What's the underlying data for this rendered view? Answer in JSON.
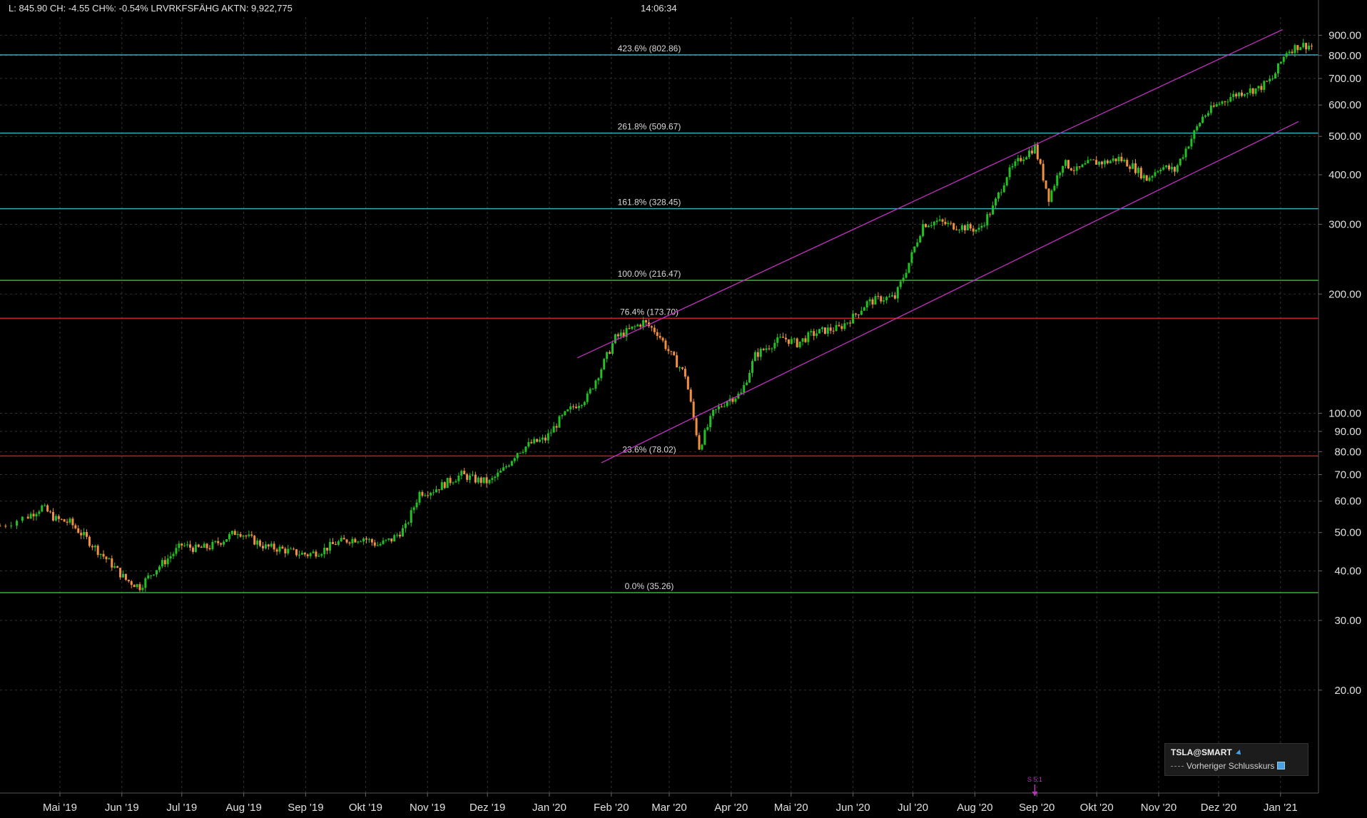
{
  "header": {
    "quote": "L: 845.90 CH: -4.55 CH%: -0.54% LRVRKFSFÄHG AKTN: 9,922,775",
    "time": "14:06:34"
  },
  "legend": {
    "title": "TSLA@SMART",
    "subtitle": "Vorheriger Schlusskurs"
  },
  "event_marker": "S 5:1",
  "colors": {
    "background": "#000000",
    "up": "#22c022",
    "down": "#f09040",
    "channel": "#c030c0",
    "fib_cyan": "#3aa8b8",
    "fib_green": "#36b236",
    "fib_red": "#c02020",
    "grid": "#333333"
  },
  "chart_data": {
    "type": "candlestick",
    "y_scale": "log",
    "ylim": [
      11,
      1000
    ],
    "y_ticks": [
      {
        "v": 900,
        "label": "900.00"
      },
      {
        "v": 800,
        "label": "800.00"
      },
      {
        "v": 700,
        "label": "700.00"
      },
      {
        "v": 600,
        "label": "600.00"
      },
      {
        "v": 500,
        "label": "500.00"
      },
      {
        "v": 400,
        "label": "400.00"
      },
      {
        "v": 300,
        "label": "300.00"
      },
      {
        "v": 200,
        "label": "200.00"
      },
      {
        "v": 100,
        "label": "100.00"
      },
      {
        "v": 90,
        "label": "90.00"
      },
      {
        "v": 80,
        "label": "80.00"
      },
      {
        "v": 70,
        "label": "70.00"
      },
      {
        "v": 60,
        "label": "60.00"
      },
      {
        "v": 50,
        "label": "50.00"
      },
      {
        "v": 40,
        "label": "40.00"
      },
      {
        "v": 30,
        "label": "30.00"
      },
      {
        "v": 20,
        "label": "20.00"
      }
    ],
    "x_ticks": [
      {
        "date": "2019-05-01",
        "label": "Mai '19"
      },
      {
        "date": "2019-06-01",
        "label": "Jun '19"
      },
      {
        "date": "2019-07-01",
        "label": "Jul '19"
      },
      {
        "date": "2019-08-01",
        "label": "Aug '19"
      },
      {
        "date": "2019-09-01",
        "label": "Sep '19"
      },
      {
        "date": "2019-10-01",
        "label": "Okt '19"
      },
      {
        "date": "2019-11-01",
        "label": "Nov '19"
      },
      {
        "date": "2019-12-01",
        "label": "Dez '19"
      },
      {
        "date": "2020-01-01",
        "label": "Jan '20"
      },
      {
        "date": "2020-02-01",
        "label": "Feb '20"
      },
      {
        "date": "2020-03-01",
        "label": "Mar '20"
      },
      {
        "date": "2020-04-01",
        "label": "Apr '20"
      },
      {
        "date": "2020-05-01",
        "label": "Mai '20"
      },
      {
        "date": "2020-06-01",
        "label": "Jun '20"
      },
      {
        "date": "2020-07-01",
        "label": "Jul '20"
      },
      {
        "date": "2020-08-01",
        "label": "Aug '20"
      },
      {
        "date": "2020-09-01",
        "label": "Sep '20"
      },
      {
        "date": "2020-10-01",
        "label": "Okt '20"
      },
      {
        "date": "2020-11-01",
        "label": "Nov '20"
      },
      {
        "date": "2020-12-01",
        "label": "Dez '20"
      },
      {
        "date": "2021-01-01",
        "label": "Jan '21"
      }
    ],
    "xlim": [
      "2019-04-01",
      "2021-01-20"
    ],
    "fib_levels": [
      {
        "label": "423.6% (802.86)",
        "value": 802.86,
        "color": "#3aa8b8"
      },
      {
        "label": "261.8% (509.67)",
        "value": 509.67,
        "color": "#3aa8b8"
      },
      {
        "label": "161.8% (328.45)",
        "value": 328.45,
        "color": "#3aa8b8"
      },
      {
        "label": "100.0% (216.47)",
        "value": 216.47,
        "color": "#36b236"
      },
      {
        "label": "76.4% (173.70)",
        "value": 173.7,
        "color": "#c02020"
      },
      {
        "label": "23.6% (78.02)",
        "value": 78.02,
        "color": "#c02020"
      },
      {
        "label": "0.0% (35.26)",
        "value": 35.26,
        "color": "#36b236"
      }
    ],
    "channel": [
      {
        "x1": "2020-01-15",
        "y1": 138,
        "x2": "2021-01-02",
        "y2": 930
      },
      {
        "x1": "2020-01-27",
        "y1": 75,
        "x2": "2021-01-10",
        "y2": 545
      }
    ],
    "event_date": "2020-08-31",
    "series": [
      {
        "date": "2019-04-01",
        "close": 52.0
      },
      {
        "date": "2019-04-15",
        "close": 55.0
      },
      {
        "date": "2019-04-22",
        "close": 58.0
      },
      {
        "date": "2019-04-29",
        "close": 54.0
      },
      {
        "date": "2019-05-06",
        "close": 53.0
      },
      {
        "date": "2019-05-13",
        "close": 49.0
      },
      {
        "date": "2019-05-20",
        "close": 45.0
      },
      {
        "date": "2019-05-27",
        "close": 41.5
      },
      {
        "date": "2019-06-03",
        "close": 38.0
      },
      {
        "date": "2019-06-10",
        "close": 36.5
      },
      {
        "date": "2019-06-17",
        "close": 40.0
      },
      {
        "date": "2019-06-24",
        "close": 43.0
      },
      {
        "date": "2019-07-01",
        "close": 46.5
      },
      {
        "date": "2019-07-08",
        "close": 45.5
      },
      {
        "date": "2019-07-15",
        "close": 46.0
      },
      {
        "date": "2019-07-22",
        "close": 48.0
      },
      {
        "date": "2019-07-29",
        "close": 50.5
      },
      {
        "date": "2019-08-05",
        "close": 48.0
      },
      {
        "date": "2019-08-12",
        "close": 46.0
      },
      {
        "date": "2019-08-19",
        "close": 45.5
      },
      {
        "date": "2019-08-26",
        "close": 44.5
      },
      {
        "date": "2019-09-02",
        "close": 44.0
      },
      {
        "date": "2019-09-09",
        "close": 45.0
      },
      {
        "date": "2019-09-16",
        "close": 47.0
      },
      {
        "date": "2019-09-23",
        "close": 48.0
      },
      {
        "date": "2019-09-30",
        "close": 48.5
      },
      {
        "date": "2019-10-07",
        "close": 46.5
      },
      {
        "date": "2019-10-14",
        "close": 48.0
      },
      {
        "date": "2019-10-21",
        "close": 51.5
      },
      {
        "date": "2019-10-28",
        "close": 63.0
      },
      {
        "date": "2019-11-04",
        "close": 64.0
      },
      {
        "date": "2019-11-11",
        "close": 67.0
      },
      {
        "date": "2019-11-18",
        "close": 70.0
      },
      {
        "date": "2019-11-25",
        "close": 68.0
      },
      {
        "date": "2019-12-02",
        "close": 67.0
      },
      {
        "date": "2019-12-09",
        "close": 72.0
      },
      {
        "date": "2019-12-16",
        "close": 80.0
      },
      {
        "date": "2019-12-23",
        "close": 84.0
      },
      {
        "date": "2019-12-30",
        "close": 86.0
      },
      {
        "date": "2020-01-06",
        "close": 96.0
      },
      {
        "date": "2020-01-13",
        "close": 104.0
      },
      {
        "date": "2020-01-20",
        "close": 110.0
      },
      {
        "date": "2020-01-27",
        "close": 130.0
      },
      {
        "date": "2020-02-03",
        "close": 155.0
      },
      {
        "date": "2020-02-10",
        "close": 162.0
      },
      {
        "date": "2020-02-17",
        "close": 170.0
      },
      {
        "date": "2020-02-24",
        "close": 160.0
      },
      {
        "date": "2020-03-02",
        "close": 140.0
      },
      {
        "date": "2020-03-09",
        "close": 125.0
      },
      {
        "date": "2020-03-16",
        "close": 82.0
      },
      {
        "date": "2020-03-23",
        "close": 100.0
      },
      {
        "date": "2020-03-30",
        "close": 108.0
      },
      {
        "date": "2020-04-06",
        "close": 112.0
      },
      {
        "date": "2020-04-13",
        "close": 140.0
      },
      {
        "date": "2020-04-20",
        "close": 148.0
      },
      {
        "date": "2020-04-27",
        "close": 155.0
      },
      {
        "date": "2020-05-04",
        "close": 150.0
      },
      {
        "date": "2020-05-11",
        "close": 158.0
      },
      {
        "date": "2020-05-18",
        "close": 162.0
      },
      {
        "date": "2020-05-25",
        "close": 164.0
      },
      {
        "date": "2020-06-01",
        "close": 175.0
      },
      {
        "date": "2020-06-08",
        "close": 190.0
      },
      {
        "date": "2020-06-15",
        "close": 195.0
      },
      {
        "date": "2020-06-22",
        "close": 196.0
      },
      {
        "date": "2020-06-29",
        "close": 240.0
      },
      {
        "date": "2020-07-06",
        "close": 300.0
      },
      {
        "date": "2020-07-13",
        "close": 305.0
      },
      {
        "date": "2020-07-20",
        "close": 298.0
      },
      {
        "date": "2020-07-27",
        "close": 295.0
      },
      {
        "date": "2020-08-03",
        "close": 290.0
      },
      {
        "date": "2020-08-10",
        "close": 330.0
      },
      {
        "date": "2020-08-17",
        "close": 400.0
      },
      {
        "date": "2020-08-24",
        "close": 440.0
      },
      {
        "date": "2020-08-31",
        "close": 470.0
      },
      {
        "date": "2020-09-07",
        "close": 350.0
      },
      {
        "date": "2020-09-14",
        "close": 430.0
      },
      {
        "date": "2020-09-21",
        "close": 410.0
      },
      {
        "date": "2020-09-28",
        "close": 430.0
      },
      {
        "date": "2020-10-05",
        "close": 430.0
      },
      {
        "date": "2020-10-12",
        "close": 440.0
      },
      {
        "date": "2020-10-19",
        "close": 420.0
      },
      {
        "date": "2020-10-26",
        "close": 390.0
      },
      {
        "date": "2020-11-02",
        "close": 420.0
      },
      {
        "date": "2020-11-09",
        "close": 410.0
      },
      {
        "date": "2020-11-16",
        "close": 480.0
      },
      {
        "date": "2020-11-23",
        "close": 560.0
      },
      {
        "date": "2020-11-30",
        "close": 600.0
      },
      {
        "date": "2020-12-07",
        "close": 630.0
      },
      {
        "date": "2020-12-14",
        "close": 650.0
      },
      {
        "date": "2020-12-21",
        "close": 660.0
      },
      {
        "date": "2020-12-28",
        "close": 700.0
      },
      {
        "date": "2021-01-04",
        "close": 820.0
      },
      {
        "date": "2021-01-11",
        "close": 850.0
      },
      {
        "date": "2021-01-18",
        "close": 846.0
      }
    ]
  }
}
